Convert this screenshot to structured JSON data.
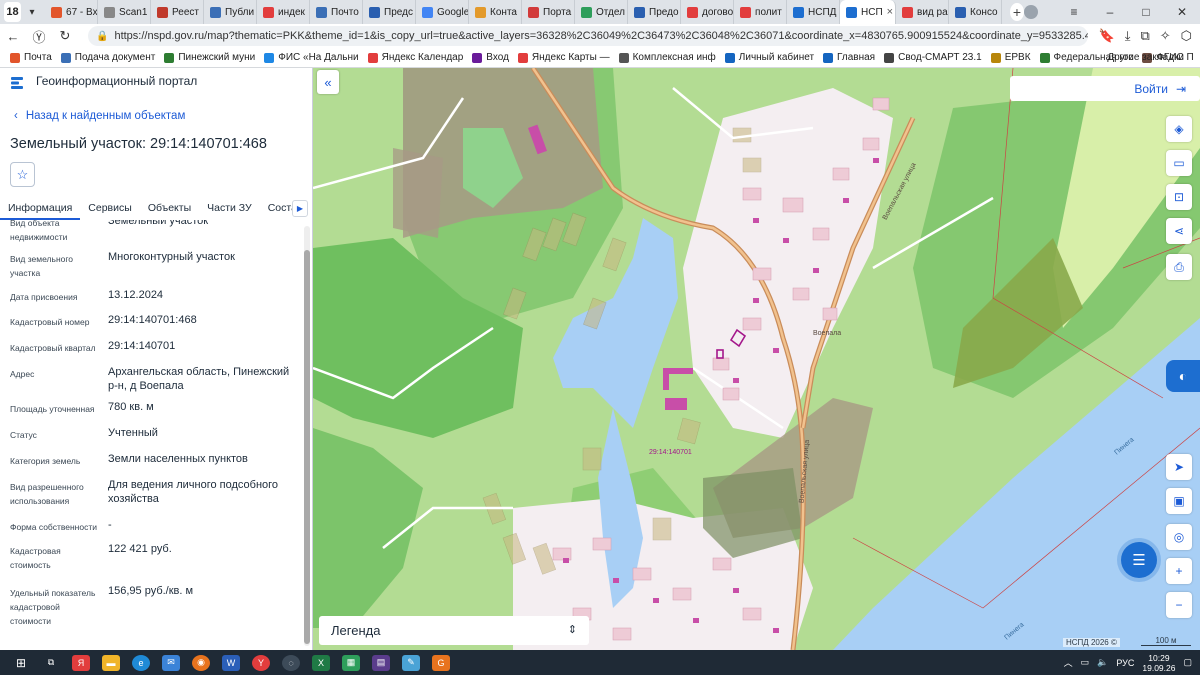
{
  "browser": {
    "tab_count": "18",
    "tabs": [
      {
        "label": "67 - Вх",
        "color": "#e2552b"
      },
      {
        "label": "Scan1",
        "color": "#888888"
      },
      {
        "label": "Реест",
        "color": "#c0392b"
      },
      {
        "label": "Публи",
        "color": "#3b6fb6"
      },
      {
        "label": "индек",
        "color": "#e23d3d"
      },
      {
        "label": "Почто",
        "color": "#3b6fb6"
      },
      {
        "label": "Предс",
        "color": "#2a5fb0"
      },
      {
        "label": "Google",
        "color": "#4285f4"
      },
      {
        "label": "Конта",
        "color": "#e39a2b"
      },
      {
        "label": "Порта",
        "color": "#d23b3b"
      },
      {
        "label": "Отдел",
        "color": "#2e9e5b"
      },
      {
        "label": "Предо",
        "color": "#2a5fb0"
      },
      {
        "label": "догово",
        "color": "#e23d3d"
      },
      {
        "label": "полит",
        "color": "#e23d3d"
      },
      {
        "label": "НСПД",
        "color": "#1d6ed0"
      },
      {
        "label": "НСП",
        "color": "#1d6ed0",
        "active": true
      },
      {
        "label": "вид ра",
        "color": "#e23d3d"
      },
      {
        "label": "Консо",
        "color": "#2a5fb0"
      }
    ],
    "url": "https://nspd.gov.ru/map?thematic=PKK&theme_id=1&is_copy_url=true&active_layers=36328%2C36049%2C36473%2C36048%2C36071&coordinate_x=4830765.900915524&coordinate_y=9533285.439914558&zo...",
    "bookmarks": [
      {
        "label": "Почта",
        "color": "#e2552b"
      },
      {
        "label": "Подача документ",
        "color": "#3b6fb6"
      },
      {
        "label": "Пинежский муни",
        "color": "#2e7d32"
      },
      {
        "label": "ФИС «На Дальни",
        "color": "#1e88e5"
      },
      {
        "label": "Яндекс Календар",
        "color": "#e23d3d"
      },
      {
        "label": "Вход",
        "color": "#6a1b9a"
      },
      {
        "label": "Яндекс Карты —",
        "color": "#e23d3d"
      },
      {
        "label": "Комплексная инф",
        "color": "#555555"
      },
      {
        "label": "Личный кабинет",
        "color": "#1565c0"
      },
      {
        "label": "Главная",
        "color": "#1565c0"
      },
      {
        "label": "Свод-СМАРТ 23.1",
        "color": "#444444"
      },
      {
        "label": "ЕРВК",
        "color": "#b8860b"
      },
      {
        "label": "Федеральная гос",
        "color": "#2e7d32"
      },
      {
        "label": "ФГИС П",
        "color": "#6d4c41"
      }
    ],
    "other_bookmarks": "Другие закладки"
  },
  "portal": {
    "title": "Геоинформационный портал",
    "back_label": "Назад к найденным объектам",
    "object_title": "Земельный участок: 29:14:140701:468",
    "tabs": [
      "Информация",
      "Сервисы",
      "Объекты",
      "Части ЗУ",
      "Состав"
    ],
    "properties": [
      {
        "label": "Вид объекта недвижимости",
        "value": "Земельный участок"
      },
      {
        "label": "Вид земельного участка",
        "value": "Многоконтурный участок"
      },
      {
        "label": "Дата присвоения",
        "value": "13.12.2024"
      },
      {
        "label": "Кадастровый номер",
        "value": "29:14:140701:468"
      },
      {
        "label": "Кадастровый квартал",
        "value": "29:14:140701"
      },
      {
        "label": "Адрес",
        "value": "Архангельская область, Пинежский р-н, д Воепала"
      },
      {
        "label": "Площадь уточненная",
        "value": "780 кв. м"
      },
      {
        "label": "Статус",
        "value": "Учтенный"
      },
      {
        "label": "Категория земель",
        "value": "Земли населенных пунктов"
      },
      {
        "label": "Вид разрешенного использования",
        "value": "Для ведения личного подсобного хозяйства"
      },
      {
        "label": "Форма собственности",
        "value": "-"
      },
      {
        "label": "Кадастровая стоимость",
        "value": "122 421 руб."
      },
      {
        "label": "Удельный показатель кадастровой стоимости",
        "value": "156,95 руб./кв. м"
      }
    ]
  },
  "map": {
    "login_label": "Войти",
    "legend_label": "Легенда",
    "copyright": "НСПД 2026 ©",
    "scale_label": "100 м",
    "labels": {
      "village": "Воепала",
      "parcel": "29:14:140701",
      "street1": "Воепальская улица",
      "street2": "Воепальская улица",
      "river": "Пинега",
      "river2": "Пинега"
    },
    "colors": {
      "meadow": "#b3dc93",
      "forest": "#7cc46a",
      "water": "#a8cff5",
      "settlement": "#f4eef1",
      "road": "#c98c5a",
      "building": "#c84ea8",
      "parcel": "#a79a85"
    }
  },
  "taskbar": {
    "language": "РУС",
    "time": "10:29",
    "date": "19.09.26"
  }
}
